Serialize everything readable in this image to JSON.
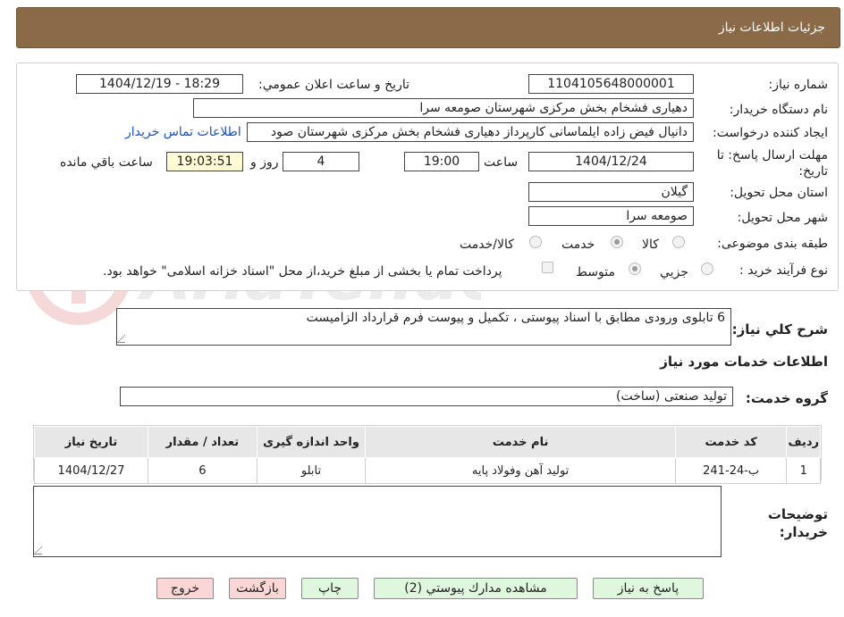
{
  "header": {
    "title": "جزئیات اطلاعات نیاز"
  },
  "form": {
    "need_number_label": "شماره نیاز:",
    "need_number": "1104105648000001",
    "announce_label": "تاریخ و ساعت اعلان عمومي:",
    "announce_value": "1404/12/19 - 18:29",
    "buyer_org_label": "نام دستگاه خريدار:",
    "buyer_org": "دهیاری فشخام بخش مرکزی شهرستان صومعه سرا",
    "creator_label": "ايجاد كننده درخواست:",
    "creator": "دانیال فیض زاده ایلماسانی کارپرداز دهیاری فشخام بخش مرکزی شهرستان صود",
    "contact_link": "اطلاعات تماس خريدار",
    "deadline_label": "مهلت ارسال پاسخ: تا تاريخ:",
    "deadline_date": "1404/12/24",
    "time_label": "ساعت",
    "deadline_time": "19:00",
    "days_value": "4",
    "days_label": "روز و",
    "remaining_time": "19:03:51",
    "remaining_label": "ساعت باقي مانده",
    "province_label": "استان محل تحويل:",
    "province": "گيلان",
    "city_label": "شهر محل تحويل:",
    "city": "صومعه سرا",
    "category_label": "طبقه بندی موضوعی:",
    "category_options": [
      "كالا",
      "خدمت",
      "كالا/خدمت"
    ],
    "category_selected": "خدمت",
    "process_label": "نوع فرآيند خريد :",
    "process_options": [
      "جزيي",
      "متوسط"
    ],
    "process_selected": "متوسط",
    "payment_note": "پرداخت تمام یا بخشی از مبلغ خرید،از محل \"اسناد خزانه اسلامی\" خواهد بود."
  },
  "summary": {
    "label": "شرح كلي نياز:",
    "text": "6 تابلوی ورودی مطابق با اسناد پیوستی ، تکمیل و پیوست فرم قرارداد الزامیست"
  },
  "services": {
    "section_title": "اطلاعات خدمات مورد نياز",
    "group_label": "گروه خدمت:",
    "group_value": "تولید صنعتی (ساخت)",
    "columns": [
      "رديف",
      "كد خدمت",
      "نام خدمت",
      "واحد اندازه گيری",
      "تعداد / مقدار",
      "تاريخ نياز"
    ],
    "rows": [
      [
        "1",
        "ب-24-241",
        "تولید آهن وفولاد پایه",
        "تابلو",
        "6",
        "1404/12/27"
      ]
    ]
  },
  "notes": {
    "label": "توضيحات خريدار:",
    "value": ""
  },
  "buttons": {
    "reply": "پاسخ به نياز",
    "view_docs": "مشاهده مدارك پيوستي (2)",
    "print": "چاپ",
    "back": "بازگشت",
    "exit": "خروج"
  },
  "colors": {
    "header_bg": "#8a6a47",
    "link": "#1a4fcf",
    "remaining_bg": "#fffbd4",
    "green_button": "#dff7dc",
    "pink_button": "#fbd6d6"
  }
}
